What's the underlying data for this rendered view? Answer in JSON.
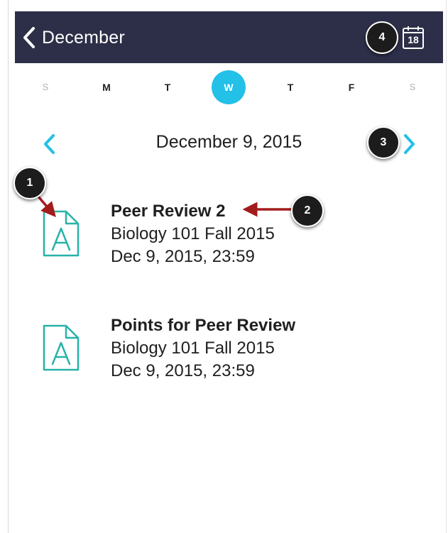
{
  "header": {
    "back_label": "December",
    "calendar_day": "18"
  },
  "weekdays": [
    {
      "label": "S",
      "weekend": true,
      "selected": false
    },
    {
      "label": "M",
      "weekend": false,
      "selected": false
    },
    {
      "label": "T",
      "weekend": false,
      "selected": false
    },
    {
      "label": "W",
      "weekend": false,
      "selected": true
    },
    {
      "label": "T",
      "weekend": false,
      "selected": false
    },
    {
      "label": "F",
      "weekend": false,
      "selected": false
    },
    {
      "label": "S",
      "weekend": true,
      "selected": false
    }
  ],
  "date_nav": {
    "current_date": "December 9, 2015"
  },
  "items": [
    {
      "title": "Peer Review 2",
      "course": "Biology 101 Fall 2015",
      "due": "Dec 9, 2015, 23:59",
      "icon": "assignment-icon"
    },
    {
      "title": "Points for Peer Review",
      "course": "Biology 101 Fall 2015",
      "due": "Dec 9, 2015, 23:59",
      "icon": "assignment-icon"
    }
  ],
  "callouts": {
    "c1": "1",
    "c2": "2",
    "c3": "3",
    "c4": "4"
  },
  "colors": {
    "navbar": "#2d2f48",
    "accent": "#23c0e7",
    "icon": "#27b3a8",
    "callout_arrow": "#a31c1c"
  }
}
